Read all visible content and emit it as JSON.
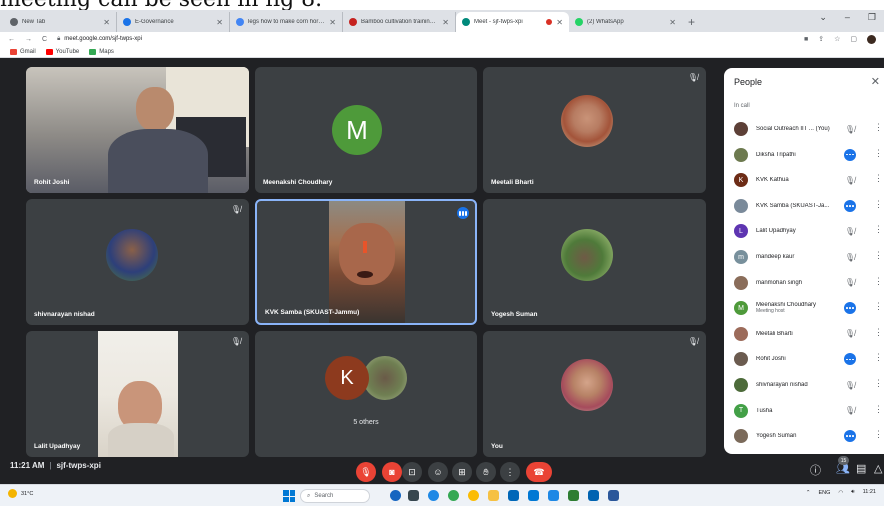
{
  "caption": "meeting can be seen in fig 8.",
  "browser": {
    "tabs": [
      {
        "title": "New Tab",
        "favicon_color": "#5f6368"
      },
      {
        "title": "E-Governance",
        "favicon_color": "#1a73e8"
      },
      {
        "title": "legs how to make corn horn box",
        "favicon_color": "#4285f4"
      },
      {
        "title": "Bamboo cultivation training at H",
        "favicon_color": "#c5221f"
      },
      {
        "title": "Meet - sjf-twps-xpi",
        "favicon_color": "#00897b",
        "active": true
      },
      {
        "title": "(2) WhatsApp",
        "favicon_color": "#25d366"
      }
    ],
    "new_tab_symbol": "+",
    "url": "meet.google.com/sjf-twps-xpi",
    "bookmarks": [
      {
        "label": "Gmail",
        "color": "#ea4335"
      },
      {
        "label": "YouTube",
        "color": "#ff0000"
      },
      {
        "label": "Maps",
        "color": "#34a853"
      }
    ]
  },
  "meeting": {
    "time": "11:21 AM",
    "code": "sjf-twps-xpi",
    "participants_count": "15",
    "tiles": [
      {
        "name": "Rohit Joshi",
        "kind": "video"
      },
      {
        "name": "Meenakshi Choudhary",
        "kind": "letter",
        "letter": "M",
        "color": "#4e9a3a"
      },
      {
        "name": "Meetali Bharti",
        "kind": "photo"
      },
      {
        "name": "shivnarayan nishad",
        "kind": "photo"
      },
      {
        "name": "KVK Samba (SKUAST-Jammu)",
        "kind": "video",
        "speaking": true
      },
      {
        "name": "Yogesh Suman",
        "kind": "photo"
      },
      {
        "name": "Lalit Upadhyay",
        "kind": "video"
      },
      {
        "name": "5 others",
        "kind": "group",
        "letter": "K",
        "color": "#8d3a1e"
      },
      {
        "name": "You",
        "kind": "photo"
      }
    ]
  },
  "people_panel": {
    "title": "People",
    "section": "In call",
    "rows": [
      {
        "name": "Social Outreach IIT ... (You)",
        "state": "muted",
        "av_color": "#5d4037",
        "letter": ""
      },
      {
        "name": "Diksha Tripathi",
        "state": "speaking",
        "av_color": "#6d7a4f",
        "letter": ""
      },
      {
        "name": "KVK Kathua",
        "state": "muted",
        "av_color": "#6d2c16",
        "letter": "K"
      },
      {
        "name": "KVK Samba (SKUAST-Ja...",
        "state": "speaking",
        "av_color": "#7a8a9a",
        "letter": ""
      },
      {
        "name": "Lalit Upadhyay",
        "state": "muted",
        "av_color": "#5e35b1",
        "letter": "L"
      },
      {
        "name": "mandeep kaur",
        "state": "muted",
        "av_color": "#78909c",
        "letter": "m"
      },
      {
        "name": "manmohan singh",
        "state": "muted",
        "av_color": "#8a6d5a",
        "letter": ""
      },
      {
        "name": "Meenakshi Choudhary",
        "host": "Meeting host",
        "state": "speaking",
        "av_color": "#4e9a3a",
        "letter": "M"
      },
      {
        "name": "Meetali Bharti",
        "state": "muted",
        "av_color": "#9c6b5a",
        "letter": ""
      },
      {
        "name": "Rohit Joshi",
        "state": "speaking",
        "av_color": "#6b5b4f",
        "letter": ""
      },
      {
        "name": "shivnarayan nishad",
        "state": "muted",
        "av_color": "#4d6b3a",
        "letter": ""
      },
      {
        "name": "Tusha",
        "state": "muted",
        "av_color": "#43a047",
        "letter": "T"
      },
      {
        "name": "Yogesh Suman",
        "state": "speaking",
        "av_color": "#7b6a5a",
        "letter": ""
      }
    ]
  },
  "taskbar": {
    "temperature": "31°C",
    "search_placeholder": "Search",
    "lang": "ENG",
    "clock": "11:21"
  }
}
